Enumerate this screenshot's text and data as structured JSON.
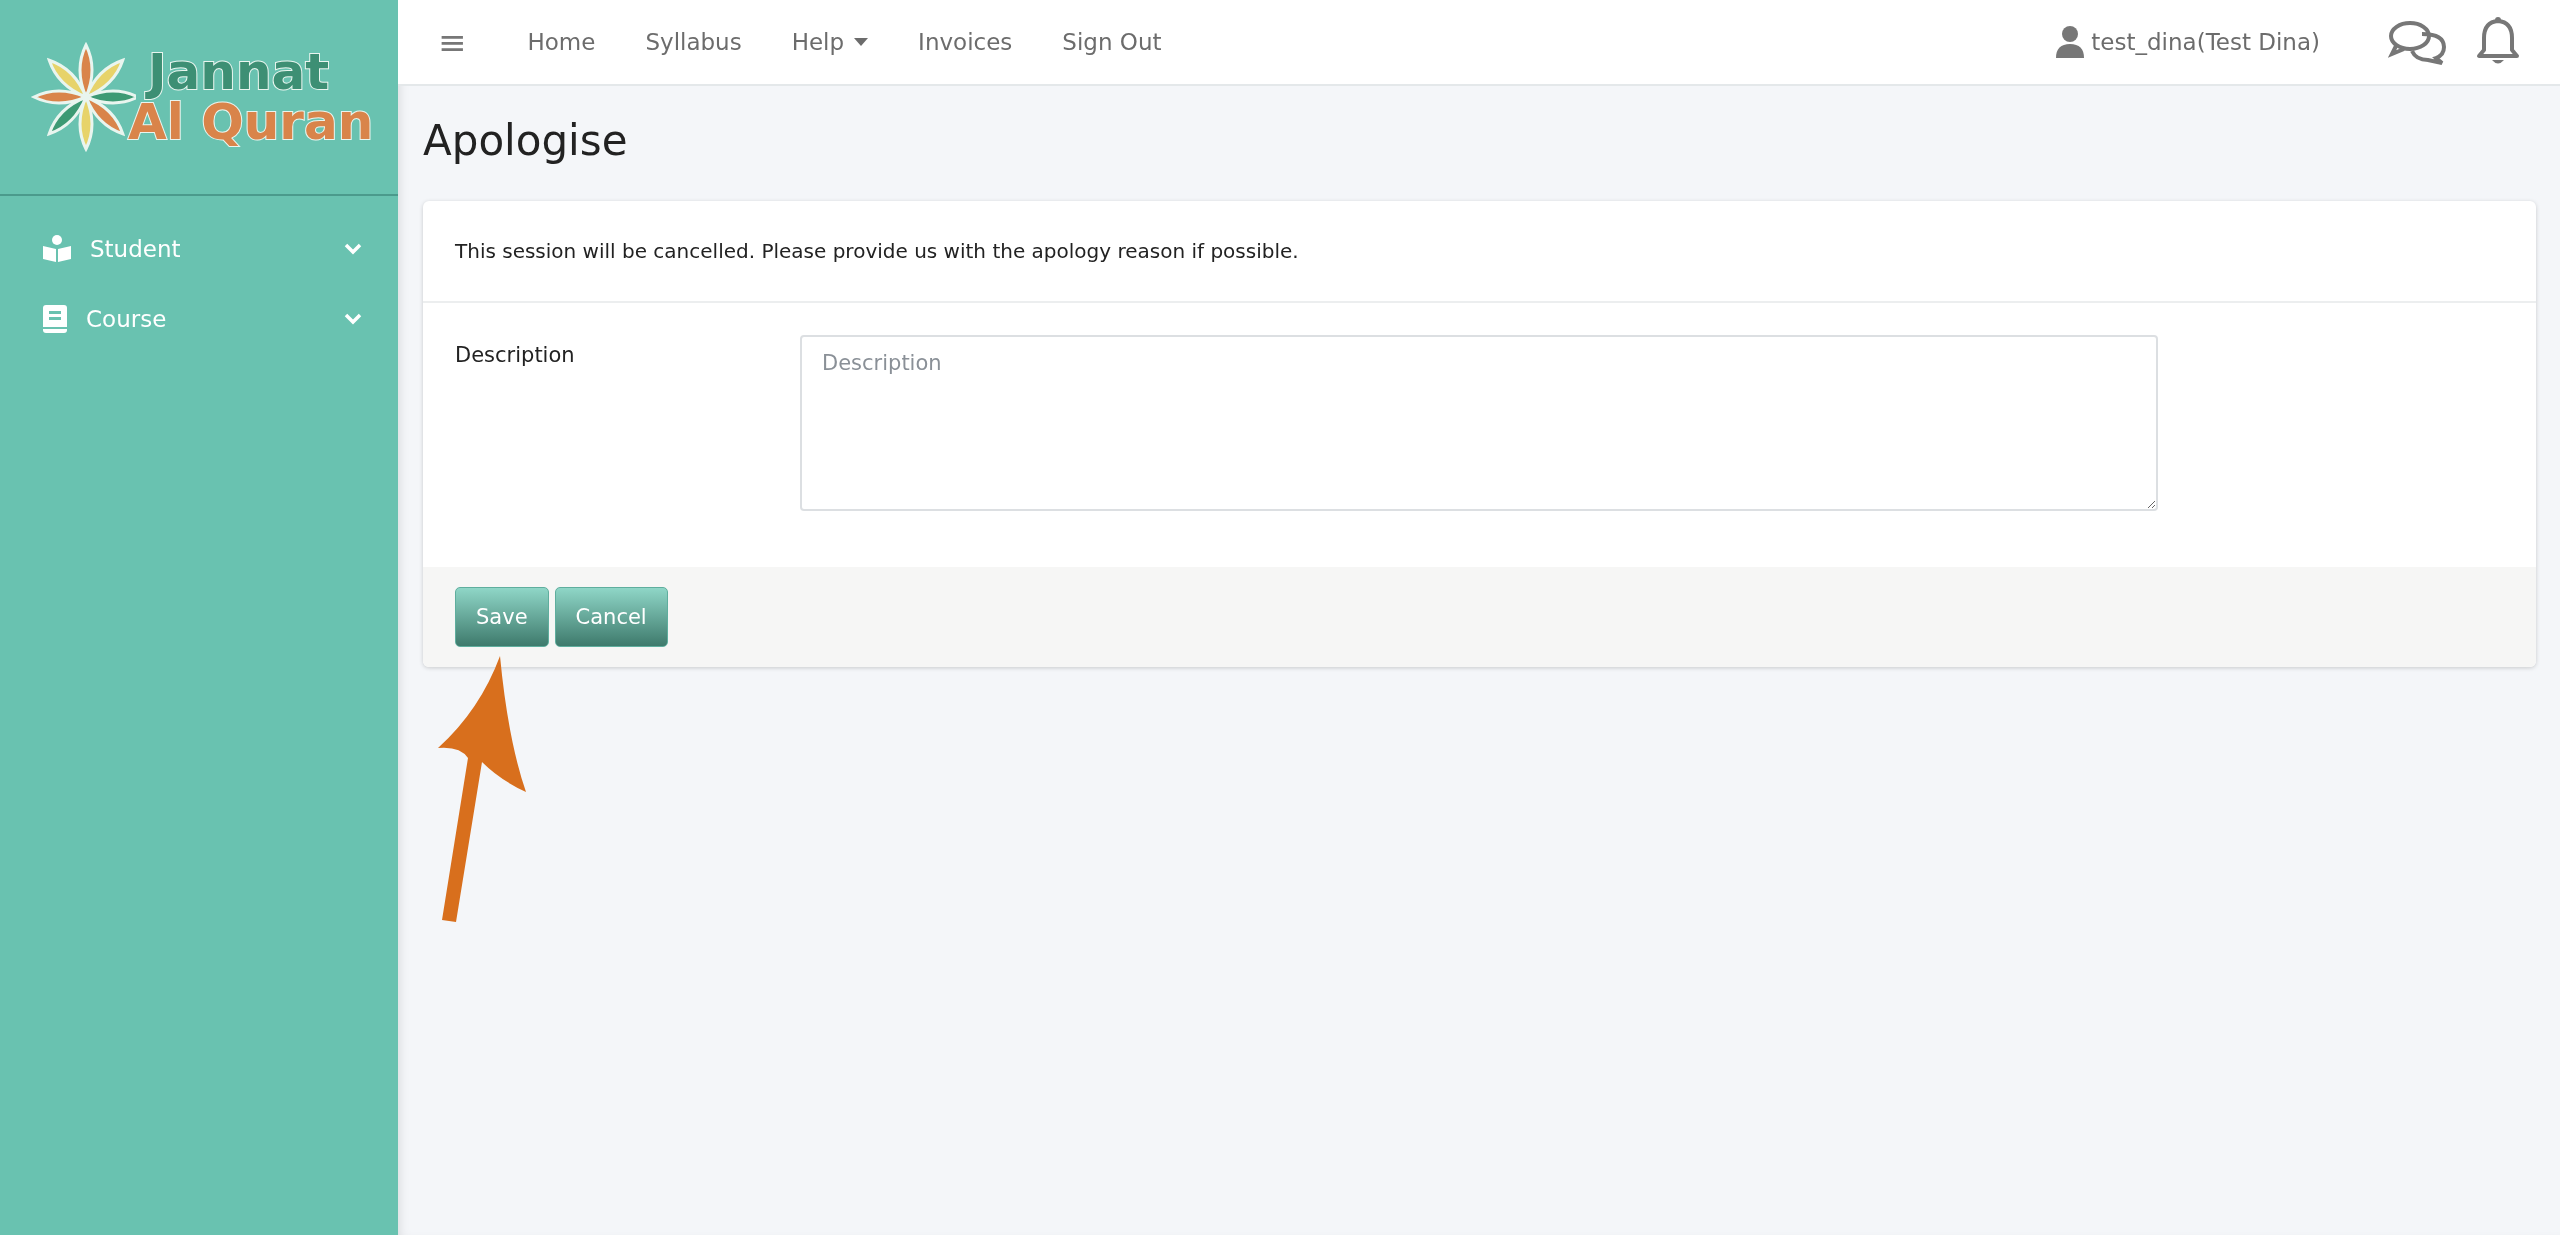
{
  "logo": {
    "line_1": "Jannat",
    "line_2": "Al Quran"
  },
  "sidebar": {
    "items": [
      {
        "label": "Student",
        "kind": "student",
        "expanded": false
      },
      {
        "label": "Course",
        "kind": "course",
        "expanded": false
      }
    ]
  },
  "topbar": {
    "menu_icon": "≡",
    "links": [
      {
        "label": "Home",
        "dropdown": false
      },
      {
        "label": "Syllabus",
        "dropdown": false
      },
      {
        "label": "Help",
        "dropdown": true
      },
      {
        "label": "Invoices",
        "dropdown": false
      },
      {
        "label": "Sign Out",
        "dropdown": false
      }
    ],
    "user": "test_dina(Test Dina)"
  },
  "page": {
    "title": "Apologise",
    "notice": "This session will be cancelled. Please provide us with the apology reason if possible.",
    "field": {
      "label": "Description",
      "placeholder": "Description"
    },
    "buttons": [
      "Save",
      "Cancel"
    ]
  }
}
